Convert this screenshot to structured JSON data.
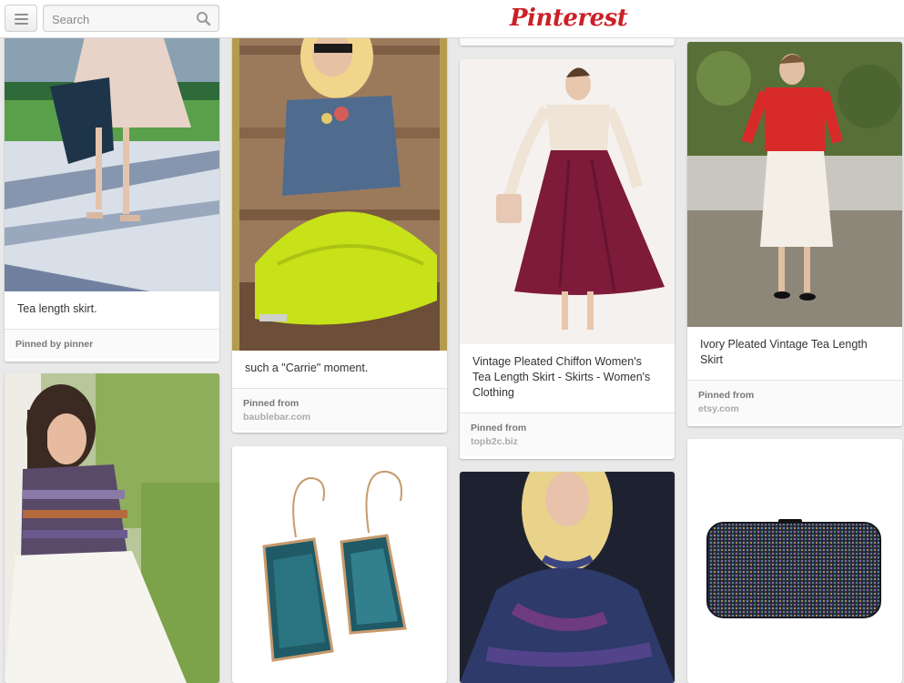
{
  "header": {
    "logo": "Pinterest",
    "search_placeholder": "Search"
  },
  "pins": {
    "tea_length_skirt": {
      "description": "Tea length skirt.",
      "pinned_label": "Pinned by pinner"
    },
    "carrie": {
      "description": "such a \"Carrie\" moment.",
      "pinned_label": "Pinned from",
      "source": "baublebar.com"
    },
    "vintage_chiffon": {
      "description": "Vintage Pleated Chiffon Women's Tea Length Skirt - Skirts - Women's Clothing",
      "pinned_label": "Pinned from",
      "source": "topb2c.biz"
    },
    "ivory_pleated": {
      "description": "Ivory Pleated Vintage Tea Length Skirt",
      "pinned_label": "Pinned from",
      "source": "etsy.com"
    }
  },
  "colors": {
    "brand": "#cb2027",
    "background": "#e9e9e9"
  }
}
